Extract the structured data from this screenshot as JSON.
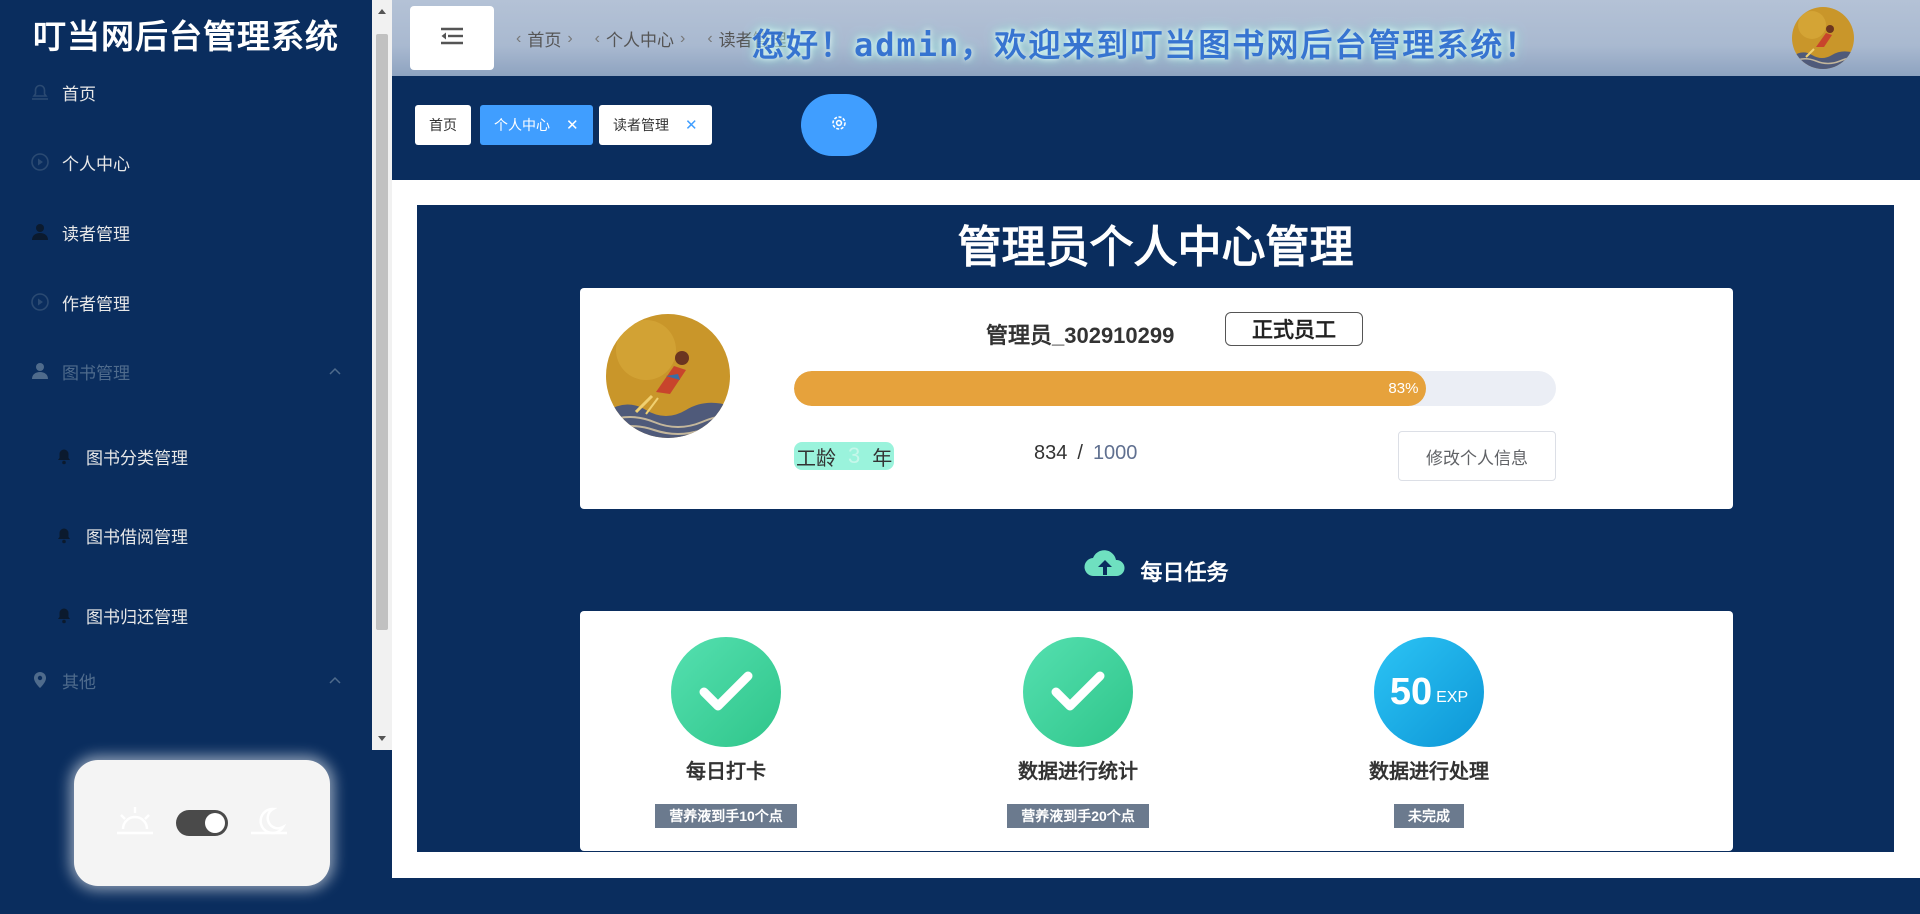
{
  "sidebar": {
    "brand": "叮当网后台管理系统",
    "items": [
      {
        "label": "首页",
        "icon": "bell-icon"
      },
      {
        "label": "个人中心",
        "icon": "play-circle-icon"
      },
      {
        "label": "读者管理",
        "icon": "user-icon"
      },
      {
        "label": "作者管理",
        "icon": "play-circle-icon"
      },
      {
        "label": "图书管理",
        "icon": "user-icon"
      },
      {
        "label": "图书分类管理",
        "icon": "bell-icon"
      },
      {
        "label": "图书借阅管理",
        "icon": "bell-icon"
      },
      {
        "label": "图书归还管理",
        "icon": "bell-icon"
      },
      {
        "label": "其他",
        "icon": "location-icon"
      }
    ]
  },
  "header": {
    "breadcrumb": [
      "首页",
      "个人中心",
      "读者管理"
    ],
    "welcome": "您好！admin，欢迎来到叮当图书网后台管理系统！"
  },
  "tabs": [
    {
      "label": "首页",
      "closable": false
    },
    {
      "label": "个人中心",
      "closable": true,
      "active": true
    },
    {
      "label": "读者管理",
      "closable": true
    }
  ],
  "main": {
    "title": "管理员个人中心管理",
    "profile": {
      "name": "管理员_302910299",
      "badge": "正式员工",
      "progress_percent": 83,
      "progress_label": "83%",
      "seniority_label": "工龄",
      "seniority_years": "3",
      "seniority_unit": "年",
      "exp_current": "834",
      "exp_max": "1000",
      "edit_button": "修改个人信息"
    },
    "tasks_title": "每日任务",
    "tasks": [
      {
        "name": "每日打卡",
        "desc": "营养液到手10个点",
        "icon": "check-icon"
      },
      {
        "name": "数据进行统计",
        "desc": "营养液到手20个点",
        "icon": "check-icon"
      },
      {
        "name": "数据进行处理",
        "desc": "未完成",
        "icon": "exp-badge",
        "badge_value": "50",
        "badge_unit": "EXP"
      }
    ]
  },
  "colors": {
    "navy": "#0a2d5e",
    "primary": "#409eff",
    "progress": "#e6a23c",
    "task_green": "#3ecf96",
    "task_blue": "#16a8e8"
  }
}
